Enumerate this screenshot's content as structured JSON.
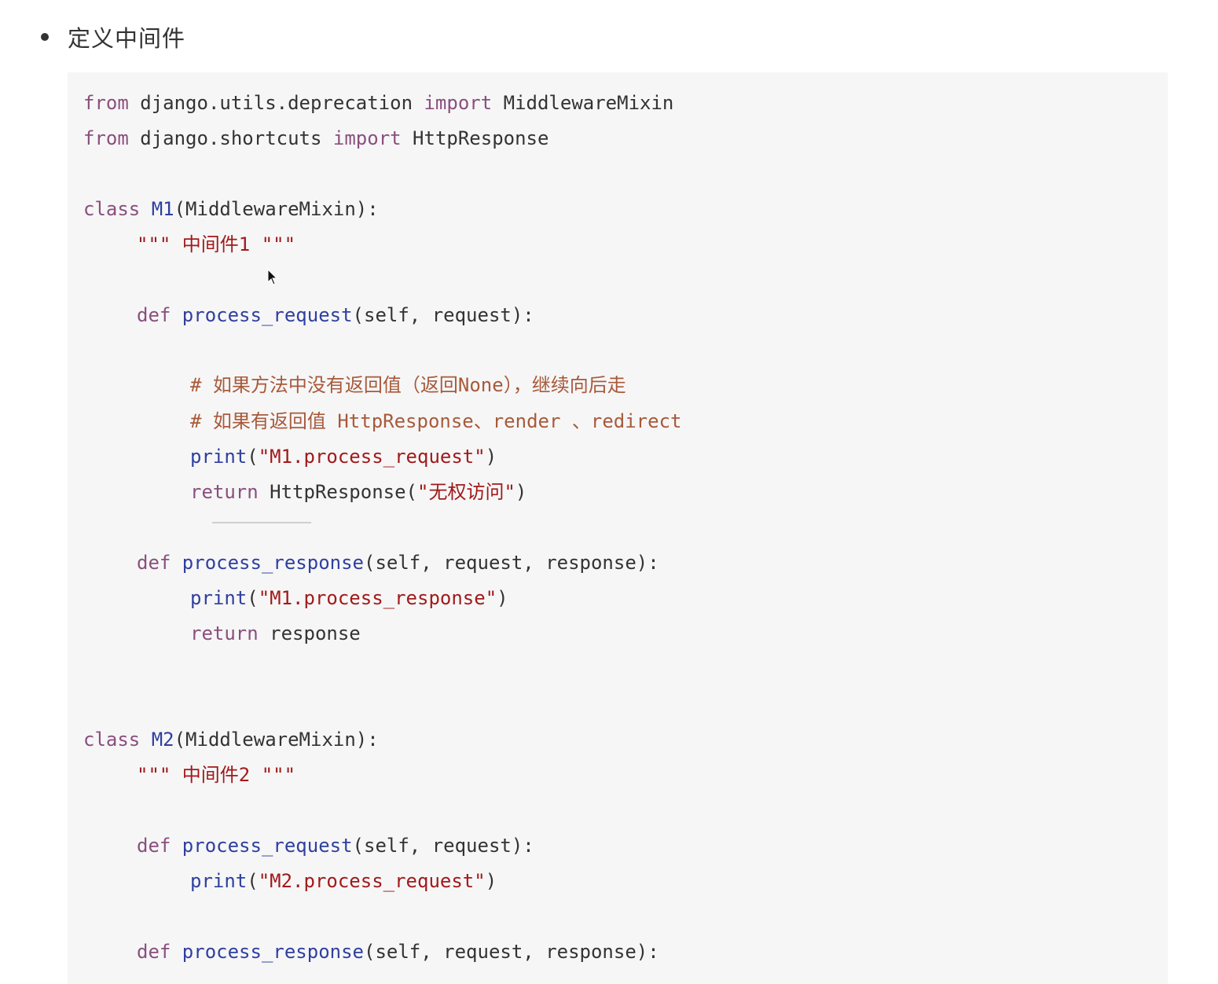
{
  "heading": "定义中间件",
  "code": {
    "line1": {
      "kw1": "from",
      "mod": " django.utils.deprecation ",
      "kw2": "import",
      "name": " MiddlewareMixin"
    },
    "line2": {
      "kw1": "from",
      "mod": " django.shortcuts ",
      "kw2": "import",
      "name": " HttpResponse"
    },
    "m1_class": {
      "kw": "class",
      "name": " M1",
      "rest": "(MiddlewareMixin):"
    },
    "m1_doc": "\"\"\" 中间件1 \"\"\"",
    "m1_req_def": {
      "kw": "def",
      "fn": " process_request",
      "rest": "(self, request):"
    },
    "m1_comment1": "# 如果方法中没有返回值（返回None），继续向后走",
    "m1_comment2": "# 如果有返回值 HttpResponse、render 、redirect",
    "m1_print": {
      "fn": "print",
      "open": "(",
      "str": "\"M1.process_request\"",
      "close": ")"
    },
    "m1_return": {
      "kw": "return",
      "rest": " HttpResponse(",
      "str": "\"无权访问\"",
      "close": ")"
    },
    "m1_resp_def": {
      "kw": "def",
      "fn": " process_response",
      "rest": "(self, request, response):"
    },
    "m1_resp_print": {
      "fn": "print",
      "open": "(",
      "str": "\"M1.process_response\"",
      "close": ")"
    },
    "m1_resp_return": {
      "kw": "return",
      "rest": " response"
    },
    "m2_class": {
      "kw": "class",
      "name": " M2",
      "rest": "(MiddlewareMixin):"
    },
    "m2_doc": "\"\"\" 中间件2 \"\"\"",
    "m2_req_def": {
      "kw": "def",
      "fn": " process_request",
      "rest": "(self, request):"
    },
    "m2_print": {
      "fn": "print",
      "open": "(",
      "str": "\"M2.process_request\"",
      "close": ")"
    },
    "m2_resp_def": {
      "kw": "def",
      "fn": " process_response",
      "rest": "(self, request, response):"
    }
  },
  "colors": {
    "keyword": "#8a4f7d",
    "function": "#2f3f9e",
    "string": "#a11a1a",
    "comment": "#a85a3a",
    "code_background": "#f6f6f7"
  },
  "icons": {
    "cursor": "mouse-pointer-icon"
  }
}
